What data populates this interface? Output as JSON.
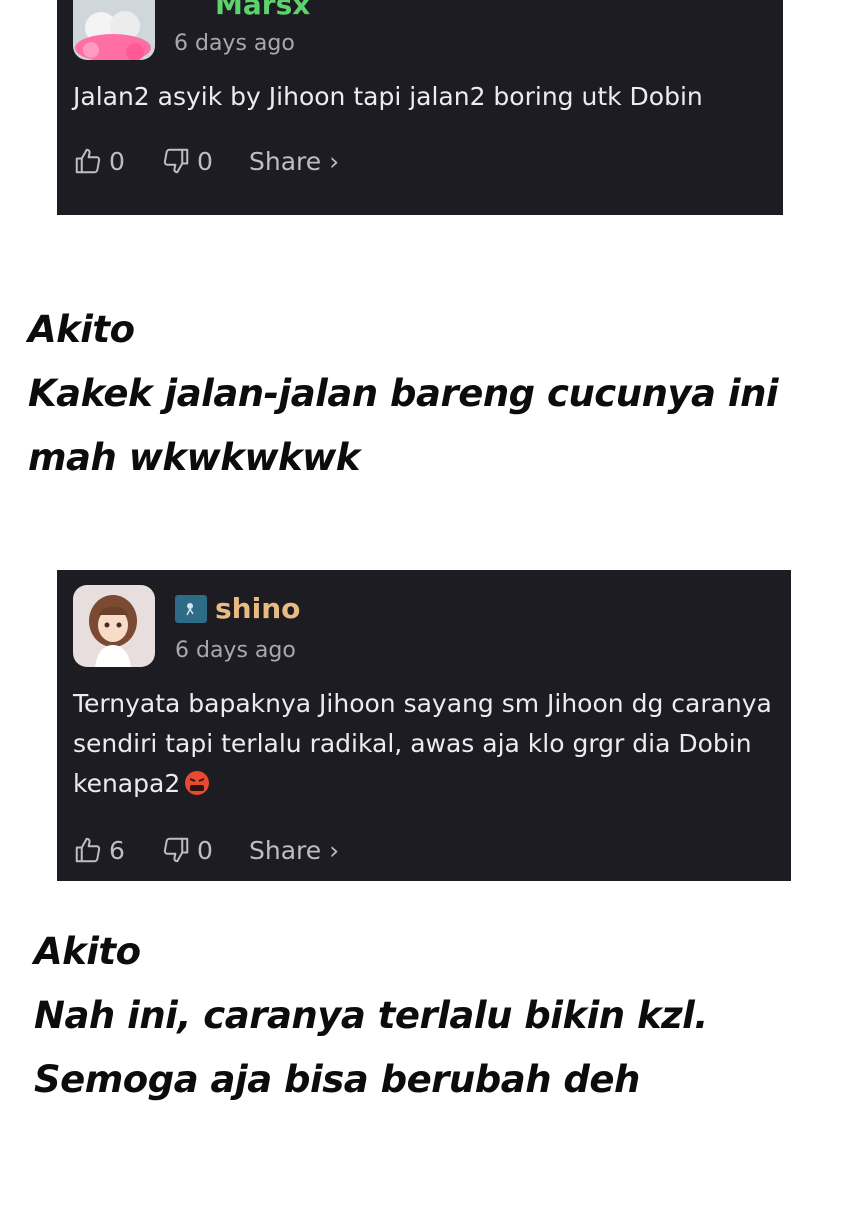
{
  "comments": [
    {
      "username": "Marsx",
      "time": "6 days ago",
      "text": "Jalan2 asyik by Jihoon tapi jalan2 boring utk Dobin",
      "likes": "0",
      "dislikes": "0",
      "share_label": "Share ›",
      "username_color": "#5dd36c",
      "avatar_icon": "kittens-avatar-icon"
    },
    {
      "username": "shino",
      "time": "6 days ago",
      "text": "Ternyata bapaknya Jihoon sayang sm Jihoon dg caranya sendiri tapi terlalu radikal, awas aja klo grgr dia Dobin kenapa2",
      "likes": "6",
      "dislikes": "0",
      "share_label": "Share ›",
      "username_color": "#e8bb82",
      "avatar_icon": "anime-girl-avatar-icon",
      "emoji": "angry-cursing-face-emoji"
    }
  ],
  "captions": [
    {
      "lines": [
        "Akito",
        "Kakek jalan-jalan bareng cucunya ini",
        "mah wkwkwkwk"
      ]
    },
    {
      "lines": [
        "Akito",
        "Nah ini, caranya terlalu bikin kzl.",
        "Semoga aja bisa berubah deh"
      ]
    }
  ],
  "colors": {
    "card_background": "#1d1c22",
    "page_background": "#ffffff"
  }
}
